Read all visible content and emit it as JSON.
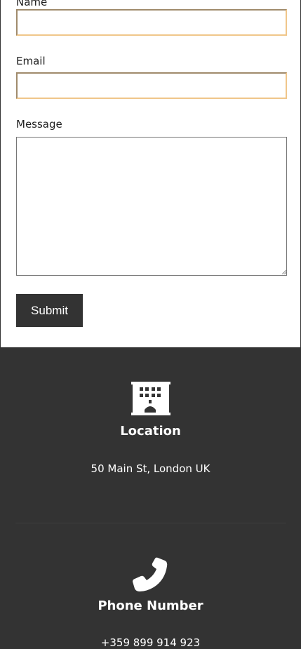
{
  "form": {
    "name_label": "Name",
    "name_value": "",
    "email_label": "Email",
    "email_value": "",
    "message_label": "Message",
    "message_value": "",
    "submit_label": "Submit"
  },
  "contact": {
    "location": {
      "icon": "building-icon",
      "title": "Location",
      "value": "50 Main St, London UK"
    },
    "phone": {
      "icon": "phone-icon",
      "title": "Phone Number",
      "value": "+359 899 914 923"
    }
  },
  "colors": {
    "footer_bg": "#333333",
    "input_focus_border": "#f0c68a",
    "button_bg": "#333333"
  }
}
